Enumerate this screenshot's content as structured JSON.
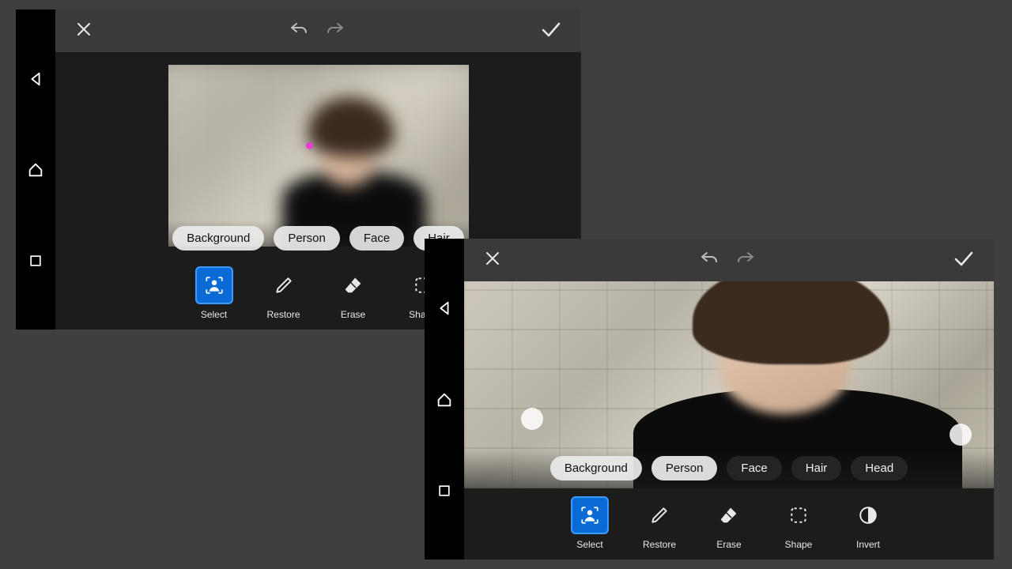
{
  "phoneA": {
    "chips": [
      {
        "label": "Background",
        "active": false
      },
      {
        "label": "Person",
        "active": false
      },
      {
        "label": "Face",
        "active": true
      },
      {
        "label": "Hair",
        "active": false
      }
    ],
    "tools": [
      {
        "label": "Select",
        "active": true
      },
      {
        "label": "Restore",
        "active": false
      },
      {
        "label": "Erase",
        "active": false
      },
      {
        "label": "Shape",
        "active": false
      }
    ]
  },
  "phoneB": {
    "chips": [
      {
        "label": "Background",
        "active": false
      },
      {
        "label": "Person",
        "active": false
      },
      {
        "label": "Face",
        "active": false
      },
      {
        "label": "Hair",
        "active": false
      },
      {
        "label": "Head",
        "active": false
      }
    ],
    "tools": [
      {
        "label": "Select",
        "active": true
      },
      {
        "label": "Restore",
        "active": false
      },
      {
        "label": "Erase",
        "active": false
      },
      {
        "label": "Shape",
        "active": false
      },
      {
        "label": "Invert",
        "active": false
      }
    ]
  }
}
